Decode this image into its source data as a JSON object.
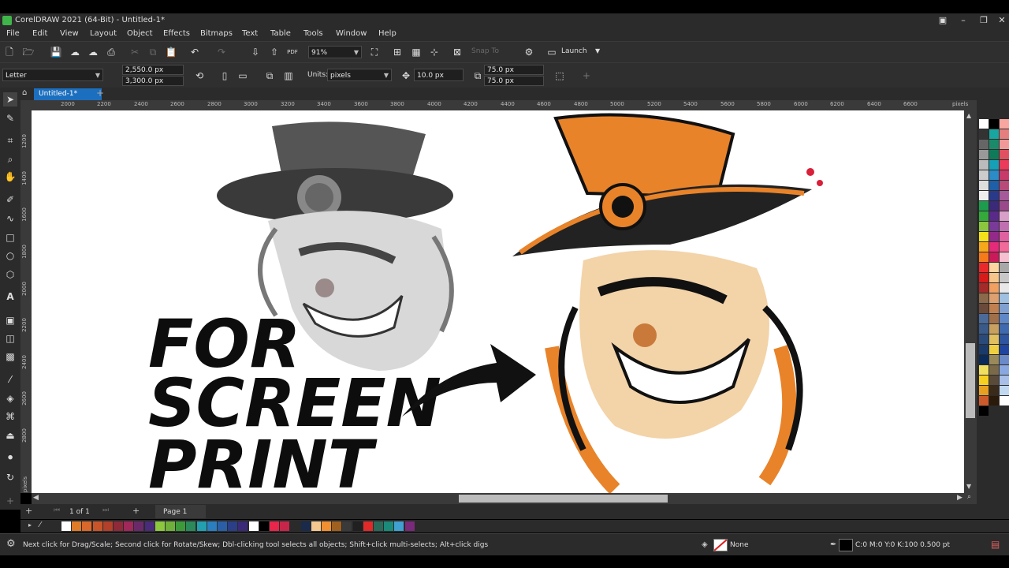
{
  "window": {
    "title": "CorelDRAW 2021 (64-Bit) - Untitled-1*"
  },
  "menus": [
    "File",
    "Edit",
    "View",
    "Layout",
    "Object",
    "Effects",
    "Bitmaps",
    "Text",
    "Table",
    "Tools",
    "Window",
    "Help"
  ],
  "standard_bar": {
    "zoom": "91%",
    "snap_to": "Snap To",
    "launch": "Launch"
  },
  "property_bar": {
    "page_size": "Letter",
    "width": "2,550.0 px",
    "height": "3,300.0 px",
    "units_label": "Units:",
    "units_value": "pixels",
    "nudge": "10.0 px",
    "dup_x": "75.0 px",
    "dup_y": "75.0 px"
  },
  "document_tab": "Untitled-1*",
  "ruler": {
    "h_ticks": [
      "2000",
      "2200",
      "2400",
      "2600",
      "2800",
      "3000",
      "3200",
      "3400",
      "3600",
      "3800",
      "4000",
      "4200",
      "4400",
      "4600",
      "4800",
      "5000",
      "5200",
      "5400",
      "5600",
      "5800",
      "6000",
      "6200",
      "6400",
      "6600"
    ],
    "unit": "pixels",
    "v_ticks": [
      "1200",
      "1400",
      "1600",
      "1800",
      "2000",
      "2200",
      "2400",
      "2600",
      "2800"
    ],
    "v_unit": "pixels"
  },
  "canvas": {
    "headline": [
      "FOR",
      "SCREEN",
      "PRINT"
    ]
  },
  "page_nav": {
    "position": "1 of 1",
    "page_tab": "Page 1"
  },
  "status": {
    "hint": "Next click for Drag/Scale; Second click for Rotate/Skew; Dbl-clicking tool selects all objects; Shift+click multi-selects; Alt+click digs",
    "fill": "None",
    "outline": "C:0 M:0 Y:0 K:100 0.500 pt"
  },
  "colors": {
    "accent": "#1c6fbf",
    "brand": "#3fb54a",
    "orange": "#e8832a"
  },
  "palette_colors": [
    "#ffffff",
    "#000000",
    "#f7a6a0",
    "#333333",
    "#19a5a0",
    "#e57f7f",
    "#666666",
    "#1a8a6a",
    "#f19999",
    "#999999",
    "#0e7a5a",
    "#e05060",
    "#bbbbbb",
    "#15a0b8",
    "#ec3a5a",
    "#cccccc",
    "#2c8cc8",
    "#c83a6a",
    "#dddddd",
    "#1f5fa8",
    "#b84a7a",
    "#eeeeee",
    "#2a3a8a",
    "#a65a9a",
    "#1c9c4c",
    "#3b2a7a",
    "#9a4a8a",
    "#33aa3a",
    "#5a2a8a",
    "#d8a0c8",
    "#8cc63e",
    "#7a3a9a",
    "#c070b0",
    "#f5e11a",
    "#932a8a",
    "#e060a0",
    "#f7a81a",
    "#e62a7a",
    "#f26a9a",
    "#f57a1a",
    "#ca1a5a",
    "#f7c0d0",
    "#ea2a2a",
    "#fcd5a0",
    "#a8a8a8",
    "#d71a1a",
    "#f5c58a",
    "#c8c8c8",
    "#a52a2a",
    "#f0a060",
    "#e8e8e8",
    "#8a6a4a",
    "#dda070",
    "#9fc0e0",
    "#6a4a3a",
    "#c08050",
    "#7fa0d0",
    "#4a6a9a",
    "#a0704a",
    "#5f88c8",
    "#3a5a8a",
    "#c8a060",
    "#3f6ab0",
    "#2a4a7a",
    "#e0c060",
    "#2f55a0",
    "#1a3a6a",
    "#f0d040",
    "#1f45a0",
    "#0a2a5a",
    "#9a8a5a",
    "#6a8ac8",
    "#f0e060",
    "#7a6a4a",
    "#8aa8e0",
    "#f5d020",
    "#5a4a3a",
    "#a8c0e8",
    "#e8a020",
    "#3a2a1a",
    "#c0d8f0",
    "#cc5a2a",
    "#2a1a0a",
    "#ffffff",
    "#000000"
  ],
  "bottom_palette": [
    "#ffffff",
    "#e07b2a",
    "#d9682a",
    "#c8552a",
    "#b2402a",
    "#8e2a3a",
    "#a0285a",
    "#6a2a6a",
    "#4a2a7a",
    "#8dc63f",
    "#6fb03a",
    "#3c9a3a",
    "#2a8a5a",
    "#23a0b0",
    "#2b7fc0",
    "#2a5fa8",
    "#2a3f88",
    "#3a2a78",
    "#ffffff",
    "#000000",
    "#e8254a",
    "#c8254a",
    "#2a2a2a",
    "#1a2a4a",
    "#f5c890",
    "#f09030",
    "#a06020",
    "#3a3a3a",
    "#202020",
    "#e02a2a",
    "#2a6a5a",
    "#1a8a7a",
    "#40a0d0",
    "#7a2a7a"
  ]
}
